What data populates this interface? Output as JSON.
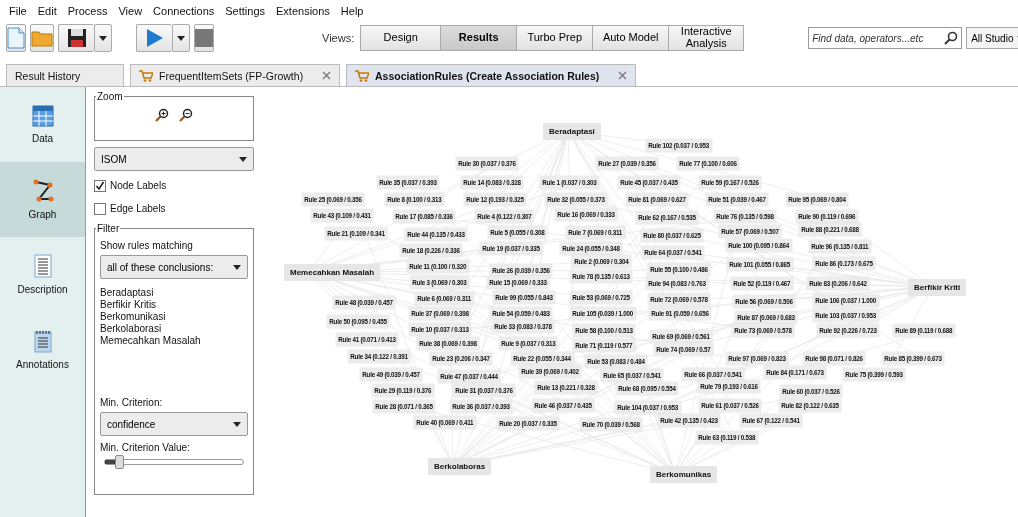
{
  "menu": [
    "File",
    "Edit",
    "Process",
    "View",
    "Connections",
    "Settings",
    "Extensions",
    "Help"
  ],
  "toolbar": {
    "views_label": "Views:",
    "views": [
      {
        "label": "Design",
        "selected": false
      },
      {
        "label": "Results",
        "selected": true
      },
      {
        "label": "Turbo Prep",
        "selected": false
      },
      {
        "label": "Auto Model",
        "selected": false
      },
      {
        "label": "Interactive Analysis",
        "selected": false
      }
    ],
    "search": {
      "placeholder": "Find data, operators...etc"
    },
    "perspective": "All Studio"
  },
  "tabs": [
    {
      "label": "Result History",
      "selected": false,
      "closable": false
    },
    {
      "label": "FrequentItemSets (FP-Growth)",
      "selected": false,
      "closable": true
    },
    {
      "label": "AssociationRules (Create Association Rules)",
      "selected": true,
      "closable": true
    }
  ],
  "side_nav": [
    {
      "label": "Data",
      "selected": false
    },
    {
      "label": "Graph",
      "selected": true
    },
    {
      "label": "Description",
      "selected": false
    },
    {
      "label": "Annotations",
      "selected": false
    }
  ],
  "panel": {
    "zoom_title": "Zoom",
    "layout_select": "ISOM",
    "checkboxes": [
      {
        "label": "Node Labels",
        "checked": true
      },
      {
        "label": "Edge Labels",
        "checked": false
      }
    ],
    "filter_title": "Filter",
    "show_rules_label": "Show rules matching",
    "match_select": "all of these conclusions:",
    "conclusions": [
      "Beradaptasi",
      "Berfikir Kritis",
      "Berkomunikasi",
      "Berkolaborasi",
      "Memecahkan Masalah"
    ],
    "min_criterion_label": "Min. Criterion:",
    "criterion_select": "confidence",
    "min_value_label": "Min. Criterion Value:",
    "slider": {
      "level": 0.1
    }
  },
  "graph": {
    "nodes": [
      "Beradaptasi",
      "Memecahkan Masalah",
      "Berfikir Kriti",
      "Berkolaboras",
      "Berkomunikas"
    ],
    "rules": [
      "Rule 102 (0.037 / 0.953",
      "Rule 30 (0.037 / 0.376",
      "Rule 27 (0.039 / 0.356",
      "Rule 77 (0.100 / 0.606",
      "Rule 35 (0.037 / 0.393",
      "Rule 14 (0.083 / 0.328",
      "Rule 1 (0.037 / 0.303",
      "Rule 45 (0.037 / 0.435",
      "Rule 59 (0.167 / 0.526",
      "Rule 25 (0.069 / 0.356",
      "Rule 8 (0.100 / 0.313",
      "Rule 12 (0.193 / 0.325",
      "Rule 32 (0.055 / 0.373",
      "Rule 81 (0.069 / 0.627",
      "Rule 51 (0.039 / 0.467",
      "Rule 95 (0.069 / 0.804",
      "Rule 43 (0.109 / 0.431",
      "Rule 17 (0.085 / 0.336",
      "Rule 4 (0.122 / 0.307",
      "Rule 16 (0.069 / 0.333",
      "Rule 62 (0.167 / 0.535",
      "Rule 76 (0.135 / 0.598",
      "Rule 90 (0.119 / 0.696",
      "Rule 21 (0.109 / 0.341",
      "Rule 44 (0.135 / 0.433",
      "Rule 5 (0.055 / 0.308",
      "Rule 7 (0.069 / 0.311",
      "Rule 80 (0.037 / 0.625",
      "Rule 57 (0.069 / 0.507",
      "Rule 88 (0.221 / 0.688",
      "Rule 18 (0.226 / 0.336",
      "Rule 19 (0.037 / 0.335",
      "Rule 24 (0.055 / 0.348",
      "Rule 64 (0.037 / 0.541",
      "Rule 100 (0.095 / 0.864",
      "Rule 96 (0.135 / 0.811",
      "Rule 2 (0.069 / 0.304",
      "Rule 101 (0.055 / 0.865",
      "Rule 86 (0.173 / 0.675",
      "Rule 11 (0.100 / 0.320",
      "Rule 26 (0.039 / 0.356",
      "Rule 55 (0.100 / 0.486",
      "Rule 78 (0.135 / 0.613",
      "Rule 3 (0.069 / 0.303",
      "Rule 15 (0.069 / 0.333",
      "Rule 94 (0.083 / 0.763",
      "Rule 52 (0.119 / 0.467",
      "Rule 83 (0.206 / 0.642",
      "Rule 48 (0.039 / 0.457",
      "Rule 6 (0.069 / 0.311",
      "Rule 99 (0.055 / 0.843",
      "Rule 53 (0.069 / 0.725",
      "Rule 72 (0.069 / 0.578",
      "Rule 56 (0.069 / 0.506",
      "Rule 106 (0.037 / 1.000",
      "Rule 37 (0.069 / 0.398",
      "Rule 54 (0.059 / 0.483",
      "Rule 105 (0.039 / 1.000",
      "Rule 91 (0.059 / 0.656",
      "Rule 87 (0.069 / 0.683",
      "Rule 103 (0.037 / 0.953",
      "Rule 50 (0.095 / 0.455",
      "Rule 10 (0.037 / 0.313",
      "Rule 33 (0.083 / 0.378",
      "Rule 58 (0.100 / 0.513",
      "Rule 69 (0.069 / 0.561",
      "Rule 73 (0.069 / 0.578",
      "Rule 92 (0.226 / 0.723",
      "Rule 89 (0.119 / 0.688",
      "Rule 41 (0.071 / 0.413",
      "Rule 38 (0.069 / 0.398",
      "Rule 9 (0.037 / 0.313",
      "Rule 71 (0.119 / 0.577",
      "Rule 74 (0.069 / 0.57",
      "Rule 34 (0.122 / 0.391",
      "Rule 23 (0.206 / 0.347",
      "Rule 22 (0.055 / 0.344",
      "Rule 53 (0.083 / 0.484",
      "Rule 97 (0.069 / 0.823",
      "Rule 98 (0.071 / 0.826",
      "Rule 85 (0.399 / 0.673",
      "Rule 49 (0.039 / 0.457",
      "Rule 47 (0.037 / 0.444",
      "Rule 39 (0.069 / 0.402",
      "Rule 65 (0.037 / 0.541",
      "Rule 66 (0.037 / 0.541",
      "Rule 84 (0.171 / 0.673",
      "Rule 75 (0.399 / 0.593",
      "Rule 29 (0.119 / 0.376",
      "Rule 31 (0.037 / 0.376",
      "Rule 13 (0.221 / 0.328",
      "Rule 68 (0.095 / 0.554",
      "Rule 79 (0.193 / 0.616",
      "Rule 60 (0.037 / 0.526",
      "Rule 28 (0.071 / 0.365",
      "Rule 36 (0.037 / 0.393",
      "Rule 46 (0.037 / 0.435",
      "Rule 104 (0.037 / 0.953",
      "Rule 61 (0.037 / 0.526",
      "Rule 82 (0.122 / 0.635",
      "Rule 40 (0.069 / 0.411",
      "Rule 20 (0.037 / 0.335",
      "Rule 70 (0.039 / 0.568",
      "Rule 42 (0.135 / 0.423",
      "Rule 67 (0.122 / 0.541",
      "Rule 63 (0.119 / 0.538"
    ]
  }
}
